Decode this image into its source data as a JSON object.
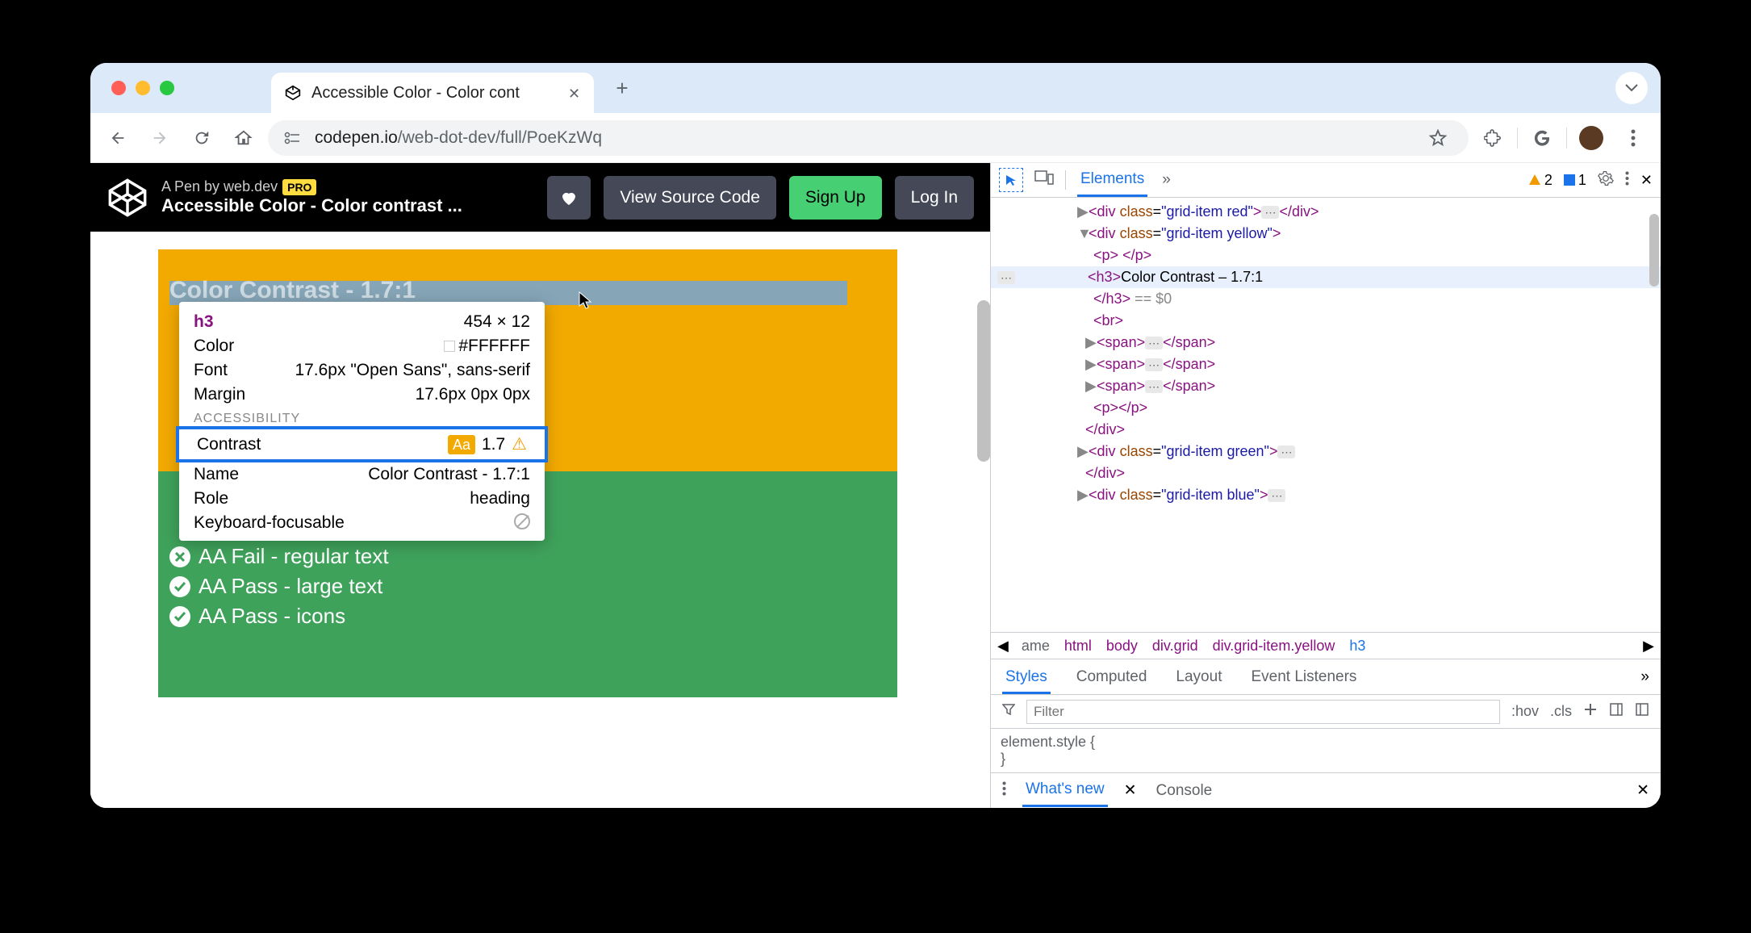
{
  "browser": {
    "tab_title": "Accessible Color - Color cont",
    "url_domain": "codepen.io",
    "url_path": "/web-dot-dev/full/PoeKzWq"
  },
  "codepen": {
    "pen_by": "A Pen by web.dev",
    "pro": "PRO",
    "title": "Accessible Color - Color contrast ...",
    "view_source": "View Source Code",
    "sign_up": "Sign Up",
    "log_in": "Log In"
  },
  "preview": {
    "yellow_heading": "Color Contrast - 1.7:1",
    "green_rows": [
      {
        "pass": false,
        "label": "AA Fail - regular text"
      },
      {
        "pass": true,
        "label": "AA Pass - large text"
      },
      {
        "pass": true,
        "label": "AA Pass - icons"
      }
    ]
  },
  "tooltip": {
    "tag": "h3",
    "dimensions": "454 × 12",
    "rows": [
      {
        "k": "Color",
        "v": "#FFFFFF",
        "swatch": true
      },
      {
        "k": "Font",
        "v": "17.6px \"Open Sans\", sans-serif"
      },
      {
        "k": "Margin",
        "v": "17.6px 0px 0px"
      }
    ],
    "accessibility_header": "ACCESSIBILITY",
    "contrast_label": "Contrast",
    "contrast_badge": "Aa",
    "contrast_value": "1.7",
    "name_label": "Name",
    "name_value": "Color Contrast - 1.7:1",
    "role_label": "Role",
    "role_value": "heading",
    "kb_label": "Keyboard-focusable"
  },
  "devtools": {
    "tabs": {
      "elements": "Elements"
    },
    "issue_warn": "2",
    "issue_info": "1",
    "dom_heading_text": "Color Contrast – 1.7:1",
    "selected_marker": "== $0",
    "breadcrumb": [
      "ame",
      "html",
      "body",
      "div.grid",
      "div.grid-item.yellow",
      "h3"
    ],
    "styles_tabs": [
      "Styles",
      "Computed",
      "Layout",
      "Event Listeners"
    ],
    "filter_placeholder": "Filter",
    "hov": ":hov",
    "cls": ".cls",
    "element_style": "element.style {",
    "element_style_close": "}",
    "drawer": {
      "whats_new": "What's new",
      "console": "Console"
    }
  }
}
